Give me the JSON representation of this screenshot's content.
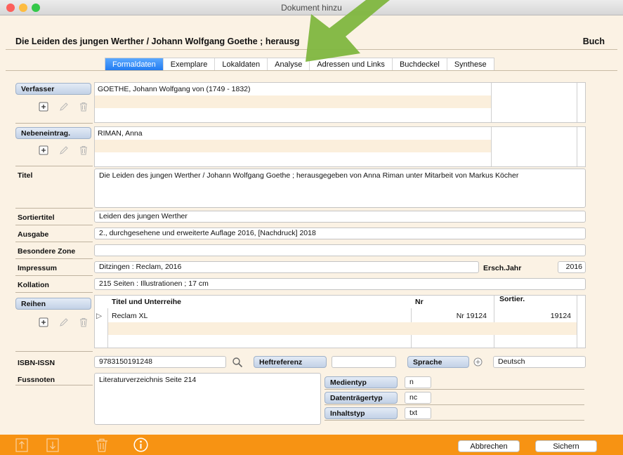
{
  "window": {
    "title": "Dokument hinzu"
  },
  "header": {
    "title": "Die Leiden des jungen Werther / Johann Wolfgang Goethe ; herausg",
    "doc_type": "Buch"
  },
  "tabs": [
    {
      "label": "Formaldaten",
      "active": true
    },
    {
      "label": "Exemplare"
    },
    {
      "label": "Lokaldaten"
    },
    {
      "label": "Analyse"
    },
    {
      "label": "Adressen und Links"
    },
    {
      "label": "Buchdeckel"
    },
    {
      "label": "Synthese"
    }
  ],
  "verfasser": {
    "label": "Verfasser",
    "value": "GOETHE, Johann Wolfgang von (1749 - 1832)"
  },
  "nebeneintrag": {
    "label": "Nebeneintrag.",
    "value": "RIMAN, Anna"
  },
  "titel": {
    "label": "Titel",
    "value": "Die Leiden des jungen Werther / Johann Wolfgang Goethe ; herausgegeben von Anna Riman unter Mitarbeit von Markus Köcher"
  },
  "sortiertitel": {
    "label": "Sortiertitel",
    "value": "Leiden des jungen Werther"
  },
  "ausgabe": {
    "label": "Ausgabe",
    "value": "2., durchgesehene und erweiterte Auflage 2016, [Nachdruck] 2018"
  },
  "besondere_zone": {
    "label": "Besondere Zone",
    "value": ""
  },
  "impressum": {
    "label": "Impressum",
    "value": "Ditzingen : Reclam, 2016",
    "jahr_label": "Ersch.Jahr",
    "jahr_value": "2016"
  },
  "kollation": {
    "label": "Kollation",
    "value": "215 Seiten : Illustrationen ; 17 cm"
  },
  "reihen": {
    "label": "Reihen",
    "columns": [
      "Titel und Unterreihe",
      "Nr",
      "Sortier."
    ],
    "rows": [
      {
        "title": "Reclam XL",
        "nr": "Nr 19124",
        "sortier": "19124"
      }
    ]
  },
  "isbn": {
    "label": "ISBN-ISSN",
    "value": "9783150191248"
  },
  "heftreferenz": {
    "label": "Heftreferenz",
    "value": ""
  },
  "sprache": {
    "label": "Sprache",
    "value": "Deutsch"
  },
  "fussnoten": {
    "label": "Fussnoten",
    "value": "Literaturverzeichnis Seite 214"
  },
  "medientyp": {
    "label": "Medientyp",
    "value": "n"
  },
  "datentraegertyp": {
    "label": "Datenträgertyp",
    "value": "nc"
  },
  "inhaltstyp": {
    "label": "Inhaltstyp",
    "value": "txt"
  },
  "footer": {
    "cancel_label": "Abbrechen",
    "save_label": "Sichern"
  },
  "icons": [
    "add-icon",
    "edit-icon",
    "trash-icon",
    "search-icon",
    "plus-circle-icon",
    "expand-triangle-icon",
    "export-icon",
    "import-icon",
    "info-icon"
  ],
  "colors": {
    "footer": "#f79313",
    "tab_active": "#2a83f6",
    "arrow": "#7fb63f"
  }
}
